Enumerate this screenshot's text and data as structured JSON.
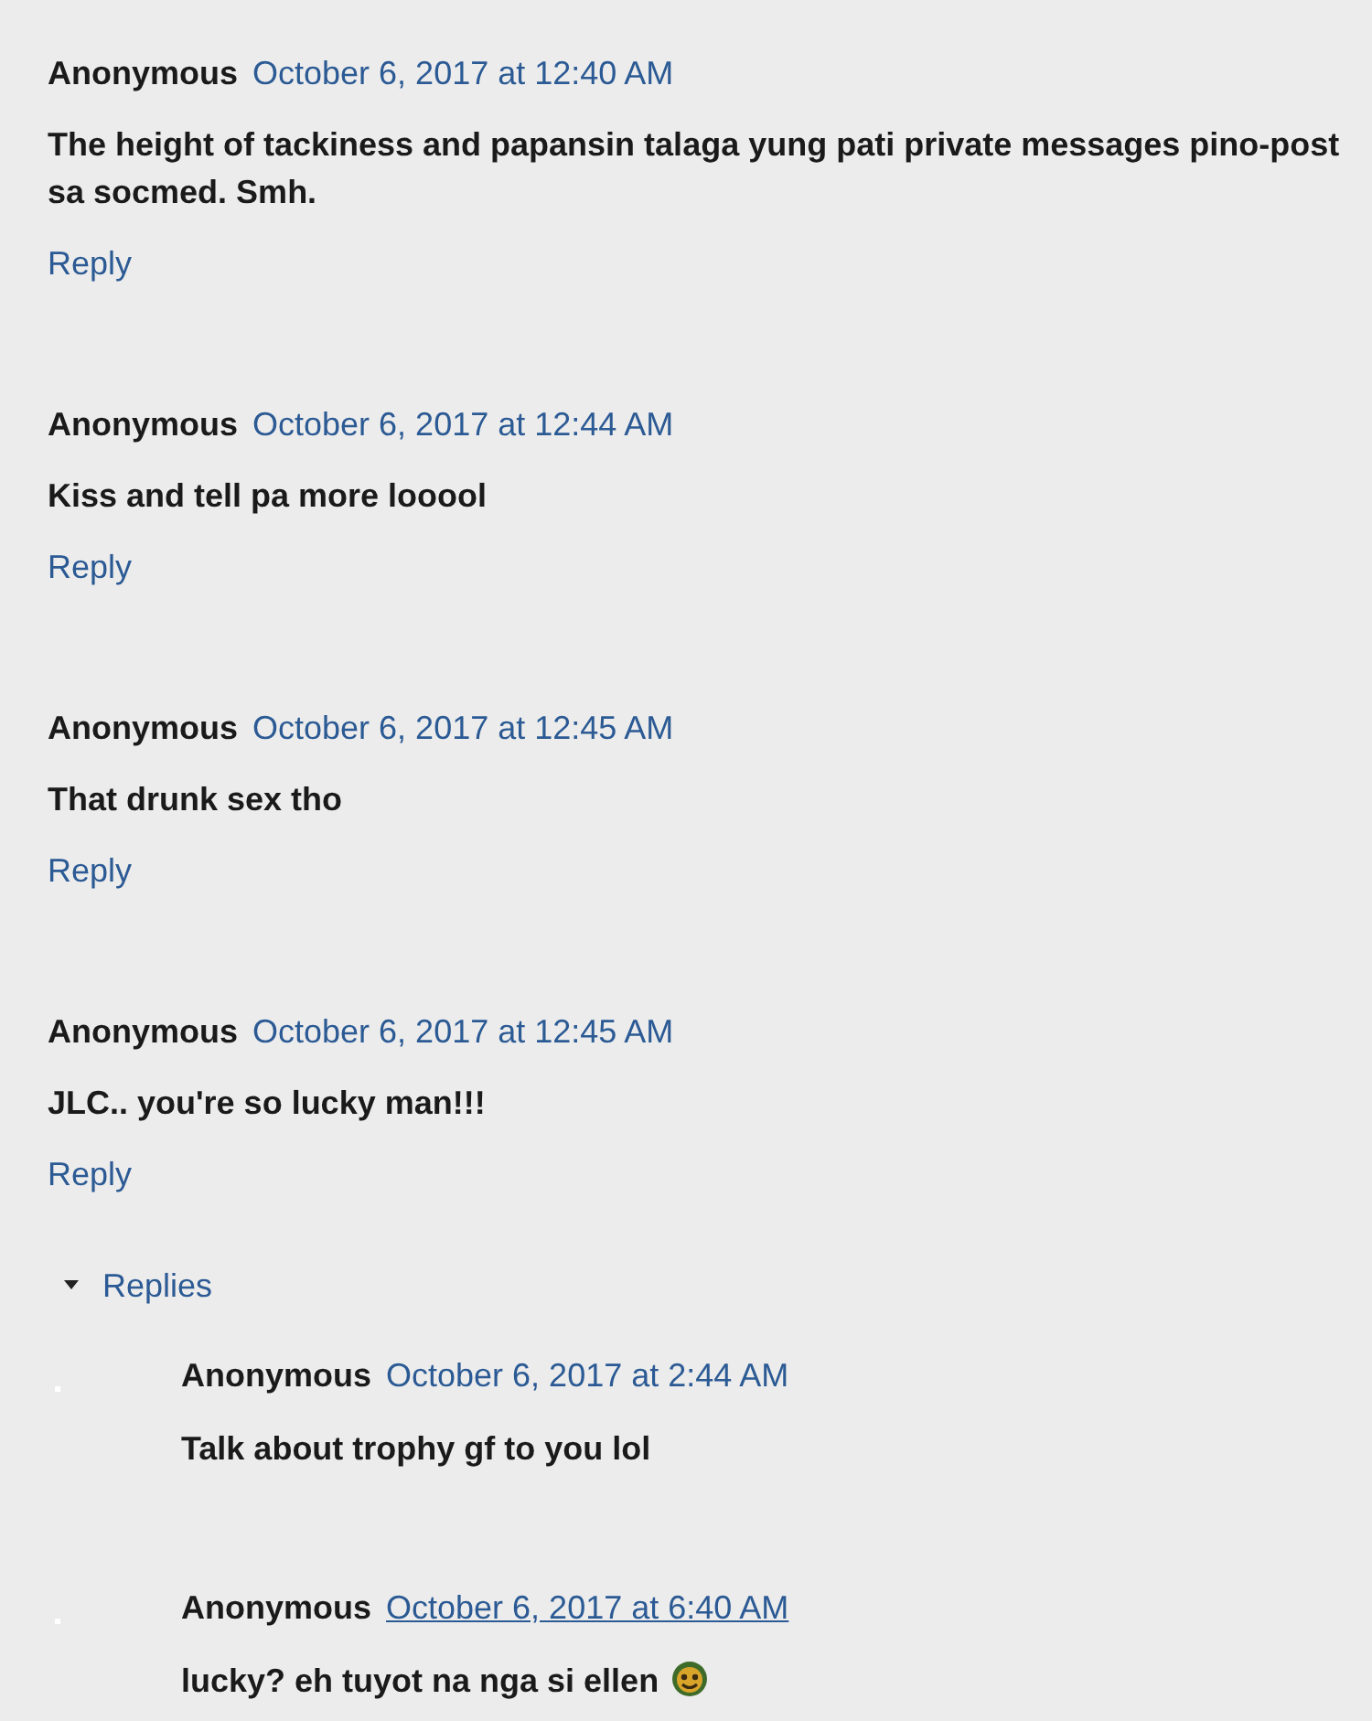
{
  "comments": [
    {
      "author": "Anonymous",
      "timestamp": "October 6, 2017 at 12:40 AM",
      "timestamp_hovered": false,
      "body": "The height of tackiness and papansin talaga yung pati private messages pino-post sa socmed. Smh.",
      "reply_link": "Reply"
    },
    {
      "author": "Anonymous",
      "timestamp": "October 6, 2017 at 12:44 AM",
      "timestamp_hovered": false,
      "body": "Kiss and tell pa more looool",
      "reply_link": "Reply"
    },
    {
      "author": "Anonymous",
      "timestamp": "October 6, 2017 at 12:45 AM",
      "timestamp_hovered": false,
      "body": "That drunk sex tho",
      "reply_link": "Reply"
    },
    {
      "author": "Anonymous",
      "timestamp": "October 6, 2017 at 12:45 AM",
      "timestamp_hovered": false,
      "body": "JLC.. you're so lucky man!!!",
      "reply_link": "Reply",
      "replies": {
        "label": "Replies",
        "expanded": true,
        "items": [
          {
            "author": "Anonymous",
            "timestamp": "October 6, 2017 at 2:44 AM",
            "timestamp_hovered": false,
            "body": "Talk about trophy gf to you lol",
            "emoji": false
          },
          {
            "author": "Anonymous",
            "timestamp": "October 6, 2017 at 6:40 AM",
            "timestamp_hovered": true,
            "body": "lucky? eh tuyot na nga si ellen",
            "emoji": true
          }
        ]
      }
    }
  ]
}
